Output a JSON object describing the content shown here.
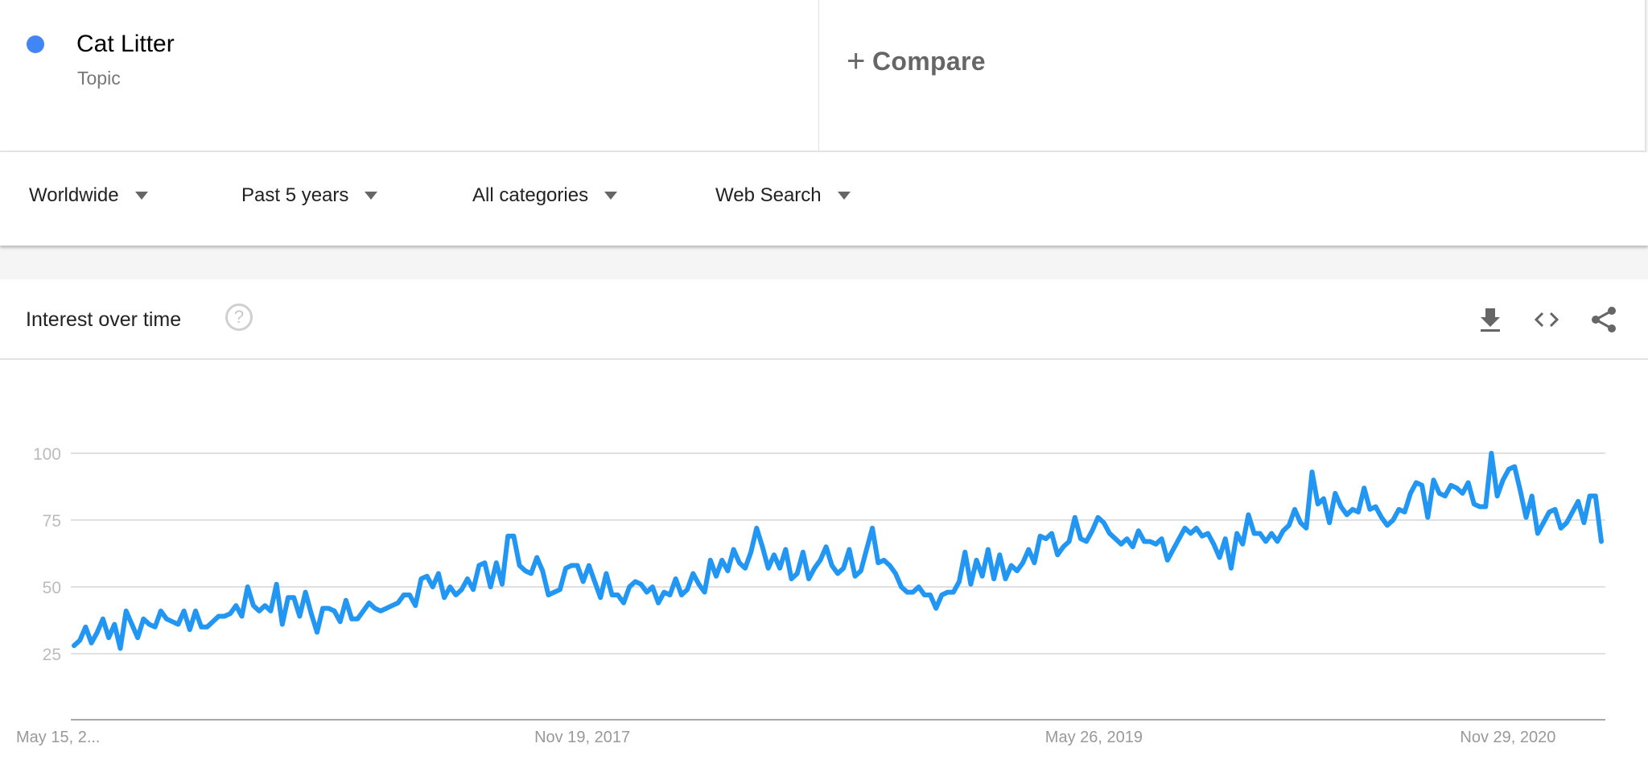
{
  "term": {
    "name": "Cat Litter",
    "type": "Topic",
    "color": "#4285f4"
  },
  "compare": {
    "label": "Compare",
    "icon": "plus-icon"
  },
  "filters": [
    {
      "label": "Worldwide"
    },
    {
      "label": "Past 5 years"
    },
    {
      "label": "All categories"
    },
    {
      "label": "Web Search"
    }
  ],
  "card": {
    "title": "Interest over time",
    "help_icon": "?",
    "actions": [
      "download-icon",
      "embed-code-icon",
      "share-icon"
    ]
  },
  "chart_data": {
    "type": "line",
    "title": "Interest over time",
    "xlabel": "",
    "ylabel": "",
    "ylim": [
      0,
      100
    ],
    "yticks": [
      25,
      50,
      75,
      100
    ],
    "xtick_labels": [
      "May 15, 2...",
      "Nov 19, 2017",
      "May 26, 2019",
      "Nov 29, 2020"
    ],
    "xtick_positions_fraction": [
      0,
      0.3333,
      0.6667,
      0.9365
    ],
    "grid": true,
    "legend": "none",
    "series": [
      {
        "name": "Cat Litter",
        "color": "#2196f3",
        "values": [
          28,
          30,
          35,
          29,
          33,
          38,
          31,
          36,
          27,
          41,
          36,
          31,
          38,
          36,
          35,
          41,
          38,
          37,
          36,
          41,
          34,
          41,
          35,
          35,
          37,
          39,
          39,
          40,
          43,
          39,
          50,
          43,
          41,
          43,
          41,
          51,
          36,
          46,
          46,
          39,
          48,
          40,
          33,
          42,
          42,
          41,
          37,
          45,
          38,
          38,
          41,
          44,
          42,
          41,
          42,
          43,
          44,
          47,
          47,
          43,
          53,
          54,
          50,
          55,
          46,
          50,
          47,
          49,
          53,
          49,
          58,
          59,
          50,
          59,
          51,
          69,
          69,
          58,
          56,
          55,
          61,
          56,
          47,
          48,
          49,
          57,
          58,
          58,
          52,
          58,
          52,
          46,
          55,
          47,
          47,
          44,
          50,
          52,
          51,
          48,
          50,
          44,
          48,
          47,
          53,
          47,
          49,
          55,
          51,
          48,
          60,
          54,
          60,
          56,
          64,
          59,
          57,
          63,
          72,
          65,
          57,
          62,
          57,
          64,
          53,
          55,
          63,
          53,
          57,
          60,
          65,
          58,
          55,
          57,
          64,
          54,
          56,
          64,
          72,
          59,
          60,
          58,
          55,
          50,
          48,
          48,
          50,
          47,
          47,
          42,
          47,
          48,
          48,
          52,
          63,
          51,
          60,
          54,
          64,
          53,
          62,
          53,
          58,
          56,
          59,
          64,
          59,
          69,
          68,
          70,
          62,
          65,
          67,
          76,
          68,
          67,
          71,
          76,
          74,
          70,
          68,
          66,
          68,
          65,
          71,
          67,
          67,
          66,
          68,
          60,
          64,
          68,
          72,
          70,
          72,
          69,
          70,
          66,
          61,
          68,
          57,
          70,
          66,
          77,
          70,
          70,
          67,
          70,
          67,
          71,
          73,
          79,
          74,
          72,
          93,
          81,
          83,
          74,
          85,
          80,
          77,
          79,
          78,
          87,
          79,
          80,
          76,
          73,
          75,
          79,
          78,
          85,
          89,
          88,
          76,
          90,
          85,
          84,
          88,
          87,
          85,
          89,
          81,
          80,
          80,
          100,
          84,
          90,
          94,
          95,
          86,
          76,
          84,
          70,
          74,
          78,
          79,
          72,
          74,
          78,
          82,
          74,
          84,
          84,
          67
        ]
      }
    ]
  }
}
